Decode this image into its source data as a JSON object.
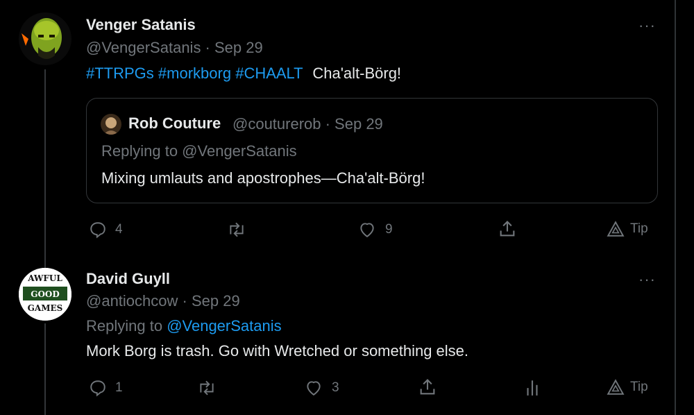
{
  "tweet1": {
    "name": "Venger Satanis",
    "handle": "@VengerSatanis · Sep 29",
    "hashtags": [
      "#TTRPGs",
      "#morkborg",
      "#CHAALT"
    ],
    "text": "Cha'alt-Börg!",
    "more": "···",
    "quote": {
      "name": "Rob Couture",
      "handle": "@couturerob · Sep 29",
      "replying": "Replying to @VengerSatanis",
      "text": "Mixing umlauts and apostrophes—Cha'alt-Börg!"
    },
    "actions": {
      "replies": "4",
      "likes": "9",
      "tip": "Tip"
    }
  },
  "tweet2": {
    "name": "David Guyll",
    "handle": "@antiochcow · Sep 29",
    "replying_prefix": "Replying to ",
    "replying_handle": "@VengerSatanis",
    "text": "Mork Borg is trash. Go with Wretched or something else.",
    "more": "···",
    "avatar_text": {
      "top": "AWFUL",
      "middle": "GOOD",
      "bottom": "GAMES"
    },
    "actions": {
      "replies": "1",
      "likes": "3",
      "tip": "Tip"
    }
  },
  "colors": {
    "background": "#000000",
    "text": "#e7e9ea",
    "muted": "#71767b",
    "accent": "#1d9bf0",
    "border": "#333639"
  }
}
